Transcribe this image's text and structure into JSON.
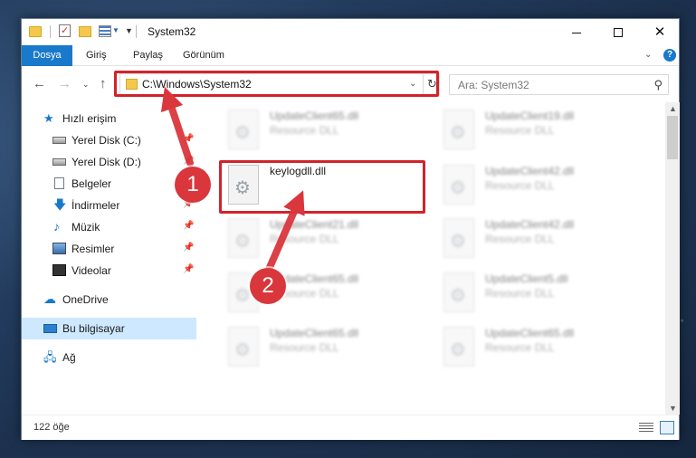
{
  "window": {
    "title": "System32",
    "minimize_label": "Minimize",
    "maximize_label": "Maximize",
    "close_label": "Close"
  },
  "ribbon": {
    "tabs": [
      "Dosya",
      "Giriş",
      "Paylaş",
      "Görünüm"
    ],
    "help_label": "?"
  },
  "address": {
    "path": "C:\\Windows\\System32"
  },
  "search": {
    "placeholder": "Ara: System32"
  },
  "sidebar": {
    "items": [
      {
        "label": "Hızlı erişim",
        "icon": "star-icon"
      },
      {
        "label": "Yerel Disk (C:)",
        "icon": "disk-icon",
        "pinned": true
      },
      {
        "label": "Yerel Disk (D:)",
        "icon": "disk-icon",
        "pinned": true
      },
      {
        "label": "Belgeler",
        "icon": "documents-icon",
        "pinned": true
      },
      {
        "label": "İndirmeler",
        "icon": "download-icon",
        "pinned": true
      },
      {
        "label": "Müzik",
        "icon": "music-icon",
        "pinned": true
      },
      {
        "label": "Resimler",
        "icon": "pictures-icon",
        "pinned": true
      },
      {
        "label": "Videolar",
        "icon": "videos-icon",
        "pinned": true
      },
      {
        "label": "OneDrive",
        "icon": "cloud-icon"
      },
      {
        "label": "Bu bilgisayar",
        "icon": "computer-icon",
        "selected": true
      },
      {
        "label": "Ağ",
        "icon": "network-icon"
      }
    ]
  },
  "files": [
    {
      "name": "UpdateClient65.dll",
      "type": "Resource DLL",
      "blurred": true
    },
    {
      "name": "UpdateClient19.dll",
      "type": "Resource DLL",
      "blurred": true
    },
    {
      "name": "keylogdll.dll",
      "type": "",
      "blurred": false
    },
    {
      "name": "UpdateClient42.dll",
      "type": "Resource DLL",
      "blurred": true
    },
    {
      "name": "UpdateClient21.dll",
      "type": "Resource DLL",
      "blurred": true
    },
    {
      "name": "UpdateClient42.dll",
      "type": "Resource DLL",
      "blurred": true
    },
    {
      "name": "UpdateClient65.dll",
      "type": "Resource DLL",
      "blurred": true
    },
    {
      "name": "UpdateClient5.dll",
      "type": "Resource DLL",
      "blurred": true
    },
    {
      "name": "UpdateClient65.dll",
      "type": "Resource DLL",
      "blurred": true
    },
    {
      "name": "UpdateClient65.dll",
      "type": "Resource DLL",
      "blurred": true
    }
  ],
  "status": {
    "item_count": "122 öğe"
  },
  "annotations": {
    "step1": "1",
    "step2": "2",
    "color": "#d2232a"
  }
}
